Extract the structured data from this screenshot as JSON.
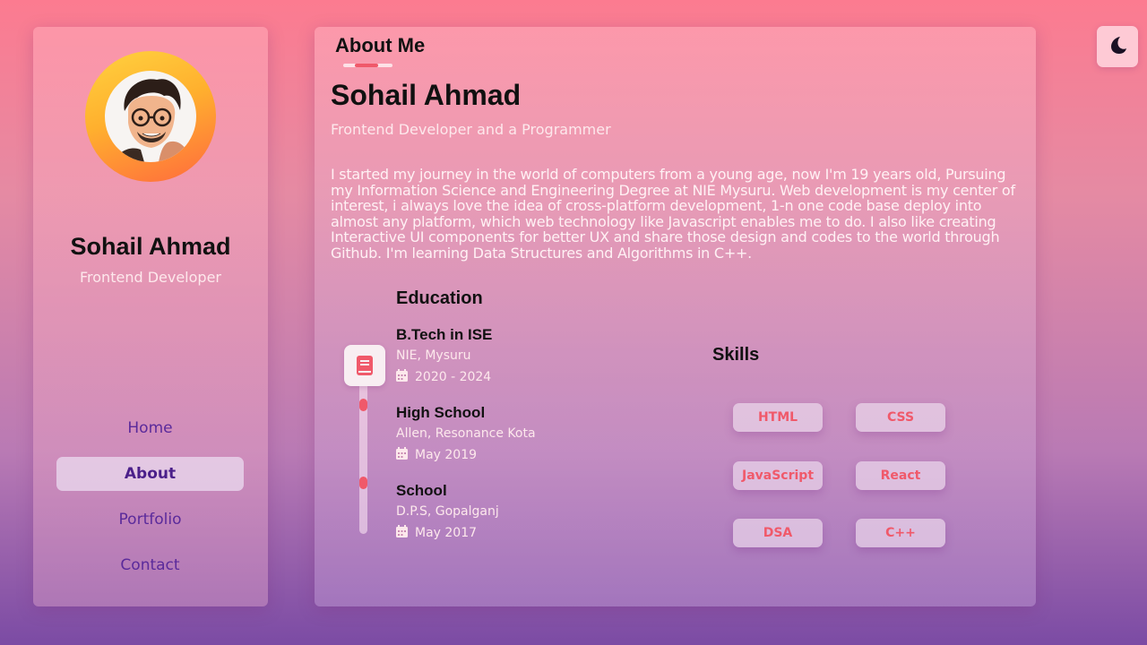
{
  "profile": {
    "name": "Sohail Ahmad",
    "role": "Frontend Developer"
  },
  "nav": {
    "items": [
      "Home",
      "About",
      "Portfolio",
      "Contact"
    ],
    "active": "About"
  },
  "about": {
    "section_title": "About Me",
    "name": "Sohail Ahmad",
    "subtitle": "Frontend Developer and a Programmer",
    "bio": "I started my journey in the world of computers from a young age, now I'm 19 years old, Pursuing my Information Science and Engineering Degree at NIE Mysuru. Web development is my center of interest, i always love the idea of cross-platform development, 1-n one code base deploy into almost any platform, which web technology like Javascript enables me to do. I also like creating Interactive UI components for better UX and share those design and codes to the world through Github. I'm learning Data Structures and Algorithms in C++."
  },
  "education": {
    "title": "Education",
    "items": [
      {
        "degree": "B.Tech in ISE",
        "place": "NIE, Mysuru",
        "date": "2020 - 2024"
      },
      {
        "degree": "High School",
        "place": "Allen, Resonance Kota",
        "date": "May 2019"
      },
      {
        "degree": "School",
        "place": "D.P.S, Gopalganj",
        "date": "May 2017"
      }
    ]
  },
  "skills": {
    "title": "Skills",
    "items": [
      "HTML",
      "CSS",
      "JavaScript",
      "React",
      "DSA",
      "C++"
    ]
  },
  "icons": {
    "theme_toggle": "moon-icon",
    "education": "book-icon",
    "date": "calendar-icon"
  },
  "colors": {
    "accent": "#f0596a",
    "nav_text": "#5a2a9b"
  }
}
